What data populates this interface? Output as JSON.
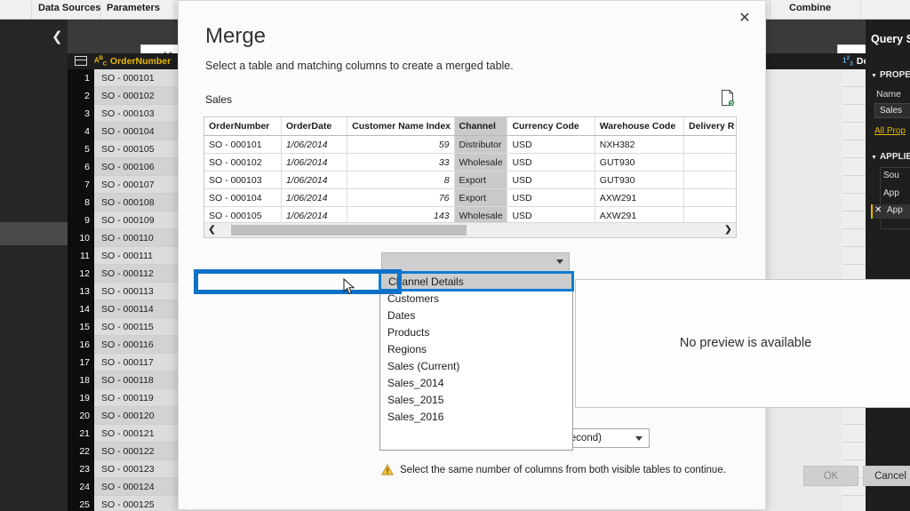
{
  "app": {
    "ribbon_groups": [
      "Data Sources",
      "Parameters",
      "Combine"
    ],
    "formula_bar": {
      "cancel_icon": "close-icon",
      "accept_icon": "check-icon",
      "fx_icon": "fx-icon",
      "chevron_icon": "chevron-down-icon"
    },
    "grid": {
      "columns": [
        {
          "name": "OrderNumber",
          "type_icon": "abc-text-icon"
        },
        {
          "name": "Delivery Region",
          "type_icon": "123-number-icon"
        }
      ],
      "rows": [
        {
          "num": "1",
          "order": "SO - 000101"
        },
        {
          "num": "2",
          "order": "SO - 000102"
        },
        {
          "num": "3",
          "order": "SO - 000103"
        },
        {
          "num": "4",
          "order": "SO - 000104"
        },
        {
          "num": "5",
          "order": "SO - 000105"
        },
        {
          "num": "6",
          "order": "SO - 000106"
        },
        {
          "num": "7",
          "order": "SO - 000107"
        },
        {
          "num": "8",
          "order": "SO - 000108"
        },
        {
          "num": "9",
          "order": "SO - 000109"
        },
        {
          "num": "10",
          "order": "SO - 000110"
        },
        {
          "num": "11",
          "order": "SO - 000111"
        },
        {
          "num": "12",
          "order": "SO - 000112"
        },
        {
          "num": "13",
          "order": "SO - 000113"
        },
        {
          "num": "14",
          "order": "SO - 000114"
        },
        {
          "num": "15",
          "order": "SO - 000115"
        },
        {
          "num": "16",
          "order": "SO - 000116"
        },
        {
          "num": "17",
          "order": "SO - 000117"
        },
        {
          "num": "18",
          "order": "SO - 000118"
        },
        {
          "num": "19",
          "order": "SO - 000119"
        },
        {
          "num": "20",
          "order": "SO - 000120"
        },
        {
          "num": "21",
          "order": "SO - 000121"
        },
        {
          "num": "22",
          "order": "SO - 000122"
        },
        {
          "num": "23",
          "order": "SO - 000123"
        },
        {
          "num": "24",
          "order": "SO - 000124"
        },
        {
          "num": "25",
          "order": "SO - 000125"
        }
      ]
    },
    "query_settings": {
      "title": "Query S",
      "properties_header": "PROPE",
      "name_label": "Name",
      "name_value": "Sales",
      "all_properties_link": "All Prop",
      "applied_steps_header": "APPLIE",
      "steps": [
        "Sou",
        "App",
        "App"
      ],
      "accent_color": "#e8b800"
    }
  },
  "dialog": {
    "title": "Merge",
    "subtitle": "Select a table and matching columns to create a merged table.",
    "close_label": "✕",
    "first_table_label": "Sales",
    "page_icon": "page-refresh-icon",
    "preview_table": {
      "headers": [
        "OrderNumber",
        "OrderDate",
        "Customer Name Index",
        "Channel",
        "Currency Code",
        "Warehouse Code",
        "Delivery R"
      ],
      "selected_column": "Channel",
      "rows": [
        [
          "SO - 000101",
          "1/06/2014",
          "59",
          "Distributor",
          "USD",
          "NXH382",
          ""
        ],
        [
          "SO - 000102",
          "1/06/2014",
          "33",
          "Wholesale",
          "USD",
          "GUT930",
          ""
        ],
        [
          "SO - 000103",
          "1/06/2014",
          "8",
          "Export",
          "USD",
          "GUT930",
          ""
        ],
        [
          "SO - 000104",
          "1/06/2014",
          "76",
          "Export",
          "USD",
          "AXW291",
          ""
        ],
        [
          "SO - 000105",
          "1/06/2014",
          "143",
          "Wholesale",
          "USD",
          "AXW291",
          ""
        ]
      ]
    },
    "table_selector": {
      "value": "",
      "arrow_icon": "chevron-down-icon",
      "options": [
        "Channel Details",
        "Customers",
        "Dates",
        "Products",
        "Regions",
        "Sales (Current)",
        "Sales_2014",
        "Sales_2015",
        "Sales_2016"
      ],
      "highlighted_option": "Channel Details",
      "highlight_color": "#0c72c8"
    },
    "preview_placeholder": "No preview is available",
    "join_kind": {
      "value": "Left Outer (all from first, matching from second)",
      "arrow_icon": "chevron-down-icon"
    },
    "warning": {
      "icon": "warning-triangle-icon",
      "text": "Select the same number of columns from both visible tables to continue."
    },
    "buttons": {
      "ok": "OK",
      "cancel": "Cancel"
    }
  }
}
